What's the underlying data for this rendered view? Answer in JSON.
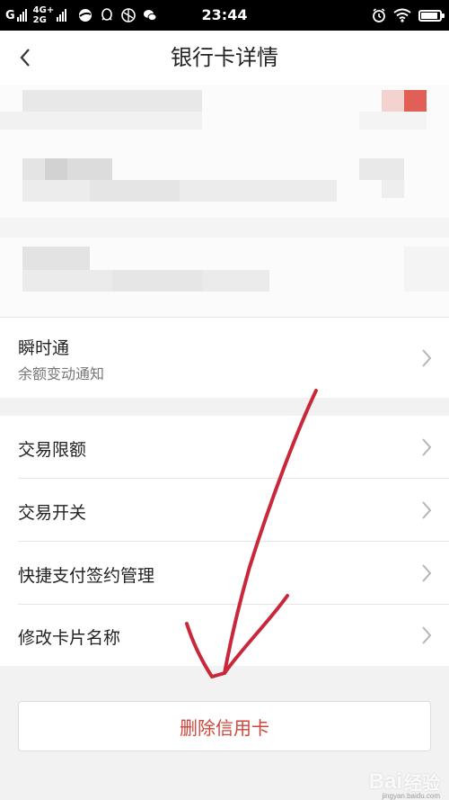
{
  "status_bar": {
    "carrier": "G",
    "network_top": "4G+",
    "network_bottom": "2G",
    "time": "23:44",
    "battery_level": 0.8,
    "icons": [
      "signal-icon",
      "browser-icon",
      "qq-icon",
      "sports-icon",
      "wechat-icon",
      "alarm-icon",
      "wifi-icon",
      "battery-icon"
    ]
  },
  "nav": {
    "title": "银行卡详情",
    "back_icon": "chevron-left-icon"
  },
  "instant_notice": {
    "title": "瞬时通",
    "subtitle": "余额变动通知"
  },
  "menu_items": [
    {
      "label": "交易限额"
    },
    {
      "label": "交易开关"
    },
    {
      "label": "快捷支付签约管理"
    },
    {
      "label": "修改卡片名称"
    }
  ],
  "delete_button": {
    "label": "删除信用卡"
  },
  "watermark": {
    "logo": "Bai",
    "suffix": "经验",
    "url": "jingyan.baidu.com"
  },
  "colors": {
    "accent_red": "#d0453a",
    "annotation_red": "#c8283a",
    "background": "#f2f2f2"
  }
}
